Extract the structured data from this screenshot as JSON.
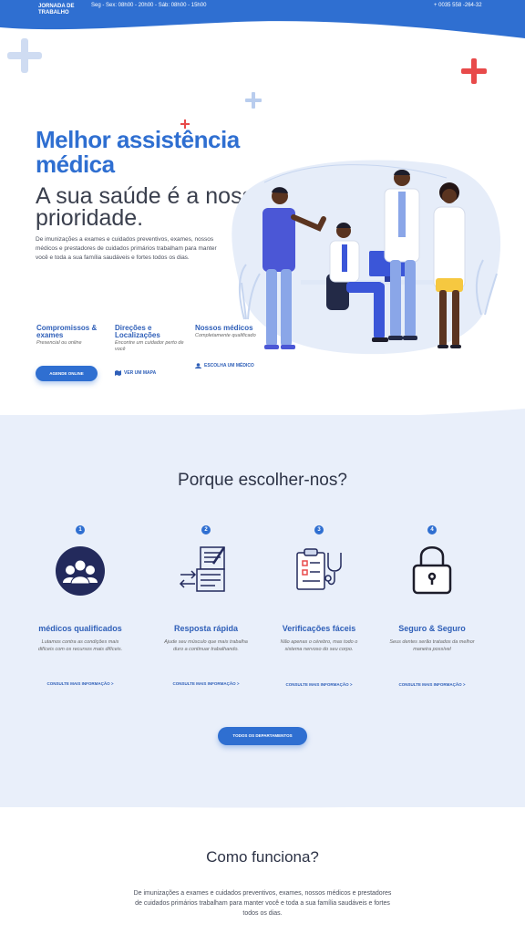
{
  "topbar": {
    "logo": "Jornada de Trabalho",
    "hours": "Seg - Sex: 08h00 - 20h00 - Sáb: 08h00 - 15h00",
    "phone": "+ 0035 558 -264-32"
  },
  "hero": {
    "title": "Melhor assistência médica",
    "subtitle": "A sua saúde é a nossa prioridade.",
    "description": "De imunizações a exames e  cuidados preventivos, exames, nossos médicos e prestadores de cuidados primários trabalham para manter você e toda a sua família saudáveis e fortes todos os dias.",
    "features": [
      {
        "title": "Compromissos & exames",
        "subtitle": "Presencial ou online"
      },
      {
        "title": "Direções e Localizações",
        "subtitle": "Encontre um cuidador perto de você"
      },
      {
        "title": "Nossos médicos",
        "subtitle": "Completamente qualificado"
      }
    ],
    "cta_label": "Agende online",
    "map_link": "Ver um mapa",
    "doctor_link": "Escolha um médico"
  },
  "why": {
    "title": "Porque escolher-nos?",
    "items": [
      {
        "number": "1",
        "title": "médicos qualificados",
        "description": "Lutamos contra as condições mais difíceis com os recursos mais difíceis.",
        "link": "Consulte mais informação >",
        "icon": "doctors-icon"
      },
      {
        "number": "2",
        "title": "Resposta rápida",
        "description": "Ajude seu músculo que mais trabalha duro a continuar trabalhando.",
        "link": "Consulte mais informação >",
        "icon": "documents-icon"
      },
      {
        "number": "3",
        "title": "Verificações fáceis",
        "description": "Não apenas o cérebro, mas todo o sistema nervoso do seu corpo.",
        "link": "Consulte mais informação >",
        "icon": "clipboard-stethoscope-icon"
      },
      {
        "number": "4",
        "title": "Seguro & Seguro",
        "description": "Seus dentes serão tratados da melhor maneira possível",
        "link": "Consulte mais informação >",
        "icon": "lock-icon"
      }
    ],
    "all_departments": "Todos os departamentos"
  },
  "how": {
    "title": "Como funciona?",
    "description": "De imunizações a exames e  cuidados preventivos,  exames, nossos médicos e prestadores de cuidados primários trabalham para manter você e toda a sua família saudáveis e fortes todos os dias."
  },
  "colors": {
    "primary": "#2f6fd1",
    "accent_red": "#e84a4a",
    "light_bg": "#e9effa",
    "dark": "#2d3346"
  }
}
